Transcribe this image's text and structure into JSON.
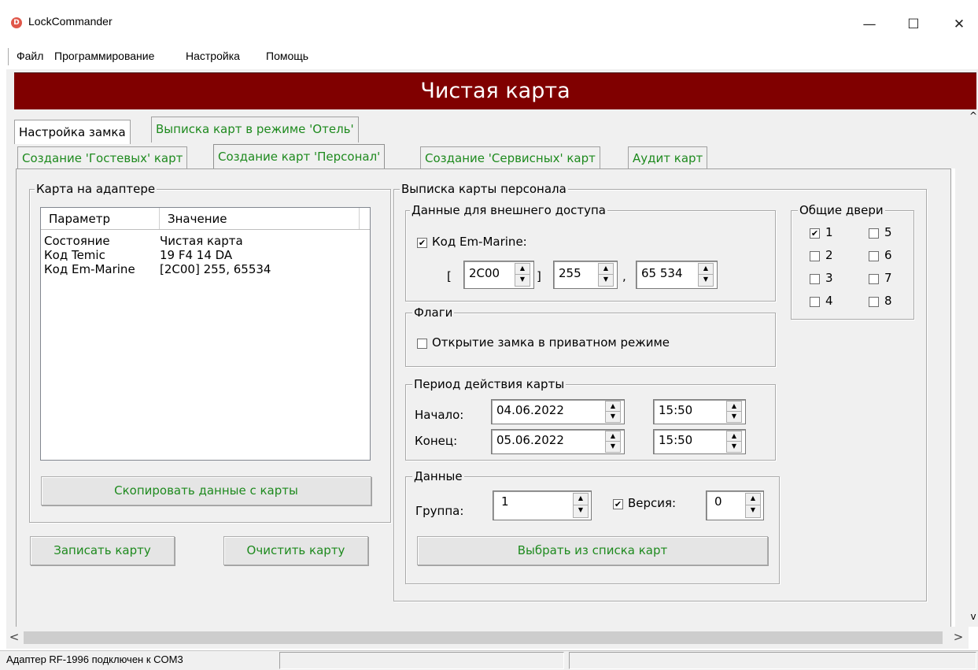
{
  "window": {
    "title": "LockCommander",
    "icon_letter": "D",
    "minimize": "—",
    "maximize": "☐",
    "close": "✕"
  },
  "menu": [
    "Файл",
    "Программирование",
    "Настройка",
    "Помощь"
  ],
  "banner": {
    "text": "Чистая карта",
    "color": "#800000"
  },
  "outer_tabs": [
    "Настройка замка",
    "Выписка карт в режиме 'Отель'"
  ],
  "inner_tabs": [
    "Создание 'Гостевых' карт",
    "Создание карт 'Персонал'",
    "Создание 'Сервисных' карт",
    "Аудит карт"
  ],
  "card_on_adapter": {
    "title": "Карта на адаптере",
    "columns": [
      "Параметр",
      "Значение"
    ],
    "rows": [
      [
        "Состояние",
        "Чистая карта"
      ],
      [
        "Код Temic",
        "19 F4 14 DA"
      ],
      [
        "Код Em-Marine",
        "[2C00] 255, 65534"
      ]
    ],
    "copy_button": "Скопировать данные с карты"
  },
  "actions": {
    "write": "Записать карту",
    "clear": "Очистить карту"
  },
  "staff_card": {
    "title": "Выписка карты персонала",
    "external": {
      "title": "Данные для внешнего доступа",
      "em_marine_label": "Код Em-Marine:",
      "em_marine_checked": true,
      "open_bracket": "[",
      "close_bracket": "]",
      "comma": ",",
      "facility": "2C00",
      "group": "255",
      "number": "65 534"
    },
    "flags": {
      "title": "Флаги",
      "private_label": "Открытие замка в приватном режиме",
      "private_checked": false
    },
    "period": {
      "title": "Период действия карты",
      "start_label": "Начало:",
      "end_label": "Конец:",
      "start_date": "04.06.2022",
      "start_time": "15:50",
      "end_date": "05.06.2022",
      "end_time": "15:50"
    },
    "data": {
      "title": "Данные",
      "group_label": "Группа:",
      "group_value": "1",
      "version_label": "Версия:",
      "version_checked": true,
      "version_value": "0",
      "choose_button": "Выбрать из списка карт"
    },
    "common_doors": {
      "title": "Общие двери",
      "doors": [
        {
          "label": "1",
          "checked": true
        },
        {
          "label": "2",
          "checked": false
        },
        {
          "label": "3",
          "checked": false
        },
        {
          "label": "4",
          "checked": false
        },
        {
          "label": "5",
          "checked": false
        },
        {
          "label": "6",
          "checked": false
        },
        {
          "label": "7",
          "checked": false
        },
        {
          "label": "8",
          "checked": false
        }
      ]
    }
  },
  "status": {
    "text": "Адаптер RF-1996 подключен к COM3"
  },
  "icons": {
    "check": "✔",
    "spin_up": "▲",
    "spin_down": "▼",
    "scroll_left": "<",
    "scroll_right": ">",
    "scroll_up": "^",
    "scroll_down": "v"
  }
}
